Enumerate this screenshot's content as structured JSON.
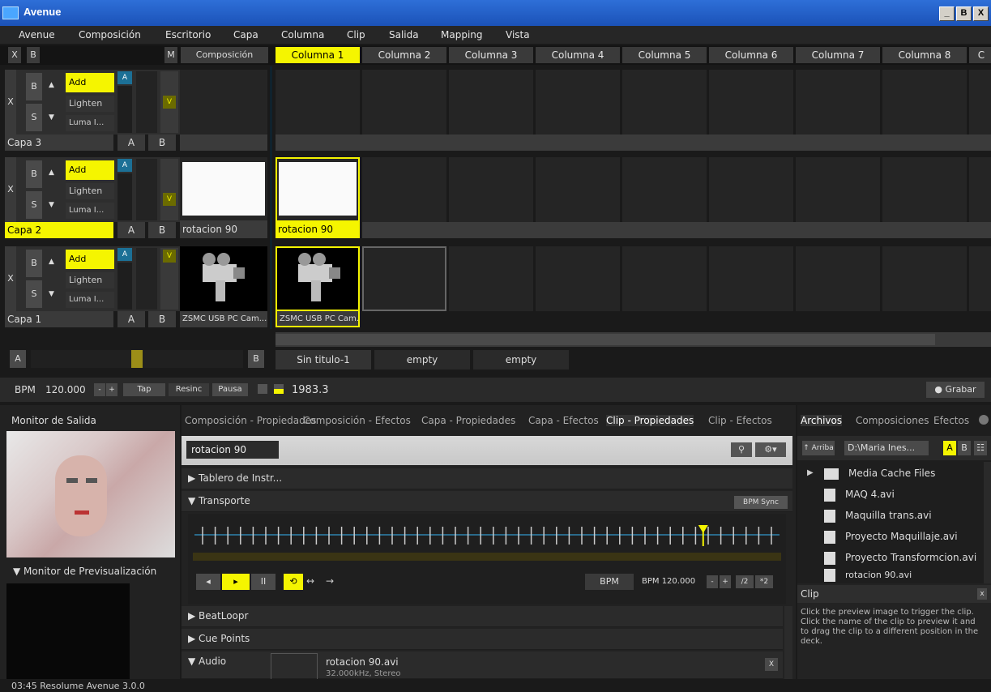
{
  "window": {
    "title": "Avenue",
    "buttons": [
      "_",
      "B",
      "X"
    ]
  },
  "menu": [
    "Avenue",
    "Composición",
    "Escritorio",
    "Capa",
    "Columna",
    "Clip",
    "Salida",
    "Mapping",
    "Vista"
  ],
  "header": {
    "x_label": "X",
    "b_label": "B",
    "m_label": "M",
    "composition_label": "Composición"
  },
  "columns": [
    "Columna 1",
    "Columna 2",
    "Columna 3",
    "Columna 4",
    "Columna 5",
    "Columna 6",
    "Columna 7",
    "Columna 8",
    "C"
  ],
  "layer_controls": {
    "x": "X",
    "b": "B",
    "s": "S",
    "up": "▲",
    "down": "▼",
    "a_btn": "A",
    "v_btn": "V",
    "ab_a": "A",
    "ab_b": "B"
  },
  "layers": [
    {
      "name": "Capa 3",
      "blend": [
        "Add",
        "Lighten",
        "Luma I..."
      ]
    },
    {
      "name": "Capa 2",
      "blend": [
        "Add",
        "Lighten",
        "Luma I..."
      ],
      "clip_left": "rotacion 90",
      "clip_1": "rotacion 90"
    },
    {
      "name": "Capa 1",
      "blend": [
        "Add",
        "Lighten",
        "Luma I..."
      ],
      "clip_left": "ZSMC USB PC Cam...",
      "clip_1": "ZSMC USB PC Cam..."
    }
  ],
  "crossfader": {
    "a": "A",
    "b": "B"
  },
  "deck_tabs": [
    "Sin titulo-1",
    "empty",
    "empty"
  ],
  "transport_bar": {
    "bpm_label": "BPM",
    "bpm_value": "120.000",
    "minus": "-",
    "plus": "+",
    "tap": "Tap",
    "resinc": "Resinc",
    "pausa": "Pausa",
    "beat_value": "1983.3",
    "grabar": "● Grabar"
  },
  "output_monitor": {
    "title": "Monitor de Salida",
    "preview_title": "▼ Monitor de Previsualización"
  },
  "props_tabs": [
    "Composición - Propiedades",
    "Composición - Efectos",
    "Capa - Propiedades",
    "Capa - Efectos",
    "Clip - Propiedades",
    "Clip - Efectos"
  ],
  "clip_props": {
    "clip_name": "rotacion 90",
    "tablero": "▶ Tablero de Instr...",
    "transporte": "▼ Transporte",
    "bpm_sync": "BPM Sync",
    "bpm_mode": "BPM",
    "bpm_readout": "BPM 120.000",
    "half": "/2",
    "double": "*2",
    "beatloopr": "▶ BeatLoopr",
    "cue_points": "▶ Cue Points",
    "audio": "▼ Audio",
    "audio_file": "rotacion 90.avi",
    "audio_info": "32.000kHz, Stereo",
    "audio_close": "X",
    "playhead_fraction": 0.88
  },
  "files_panel": {
    "tabs": [
      "Archivos",
      "Composiciones",
      "Efectos"
    ],
    "up_label": "Arriba",
    "path": "D:\\Maria Ines...",
    "a": "A",
    "b": "B",
    "items": [
      "Media Cache Files",
      "MAQ 4.avi",
      "Maquilla trans.avi",
      "Proyecto Maquillaje.avi",
      "Proyecto Transformcion.avi",
      "rotacion 90.avi"
    ]
  },
  "help_panel": {
    "title": "Clip",
    "close": "x",
    "text": "Click the preview image to trigger the clip. Click the name of the clip to preview it and to drag the clip to a different position in the deck."
  },
  "status_bar": {
    "text": "03:45  Resolume Avenue 3.0.0"
  }
}
